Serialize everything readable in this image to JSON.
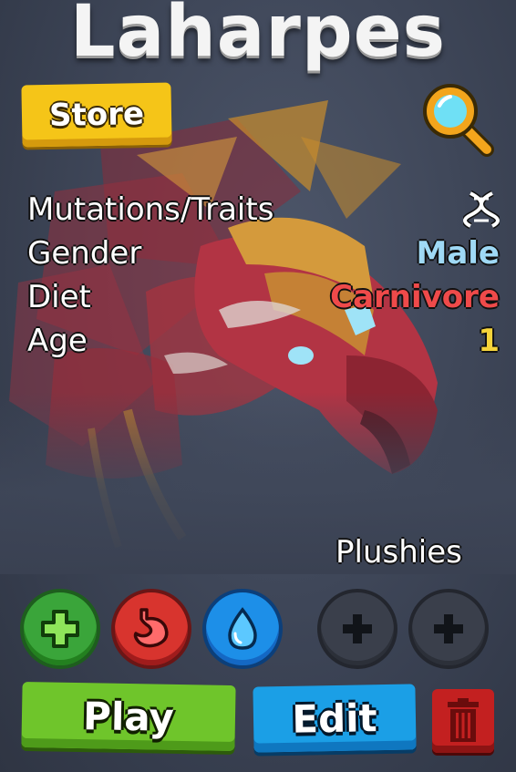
{
  "creature": {
    "name": "Laharpes"
  },
  "top_bar": {
    "store_label": "Store",
    "search_icon": "magnifying-glass-icon"
  },
  "stats": [
    {
      "label": "Mutations/Traits",
      "value_icon": "dna-icon"
    },
    {
      "label": "Gender",
      "value": "Male",
      "color": "#9fd9f5"
    },
    {
      "label": "Diet",
      "value": "Carnivore",
      "color": "#ef4a4a"
    },
    {
      "label": "Age",
      "value": "1",
      "color": "#f5d33a"
    }
  ],
  "actions": {
    "heal_icon": "plus-icon",
    "food_icon": "stomach-icon",
    "water_icon": "water-drop-icon",
    "plushies_label": "Plushies",
    "plush_slot_icon": "plus-icon"
  },
  "footer": {
    "play_label": "Play",
    "edit_label": "Edit",
    "delete_icon": "trash-icon"
  },
  "colors": {
    "store": "#f5c518",
    "play": "#6fc52b",
    "edit": "#1b9fe6",
    "delete": "#c32020",
    "heal": "#3aa53a",
    "food": "#d8342e",
    "water": "#1d8fe8"
  }
}
